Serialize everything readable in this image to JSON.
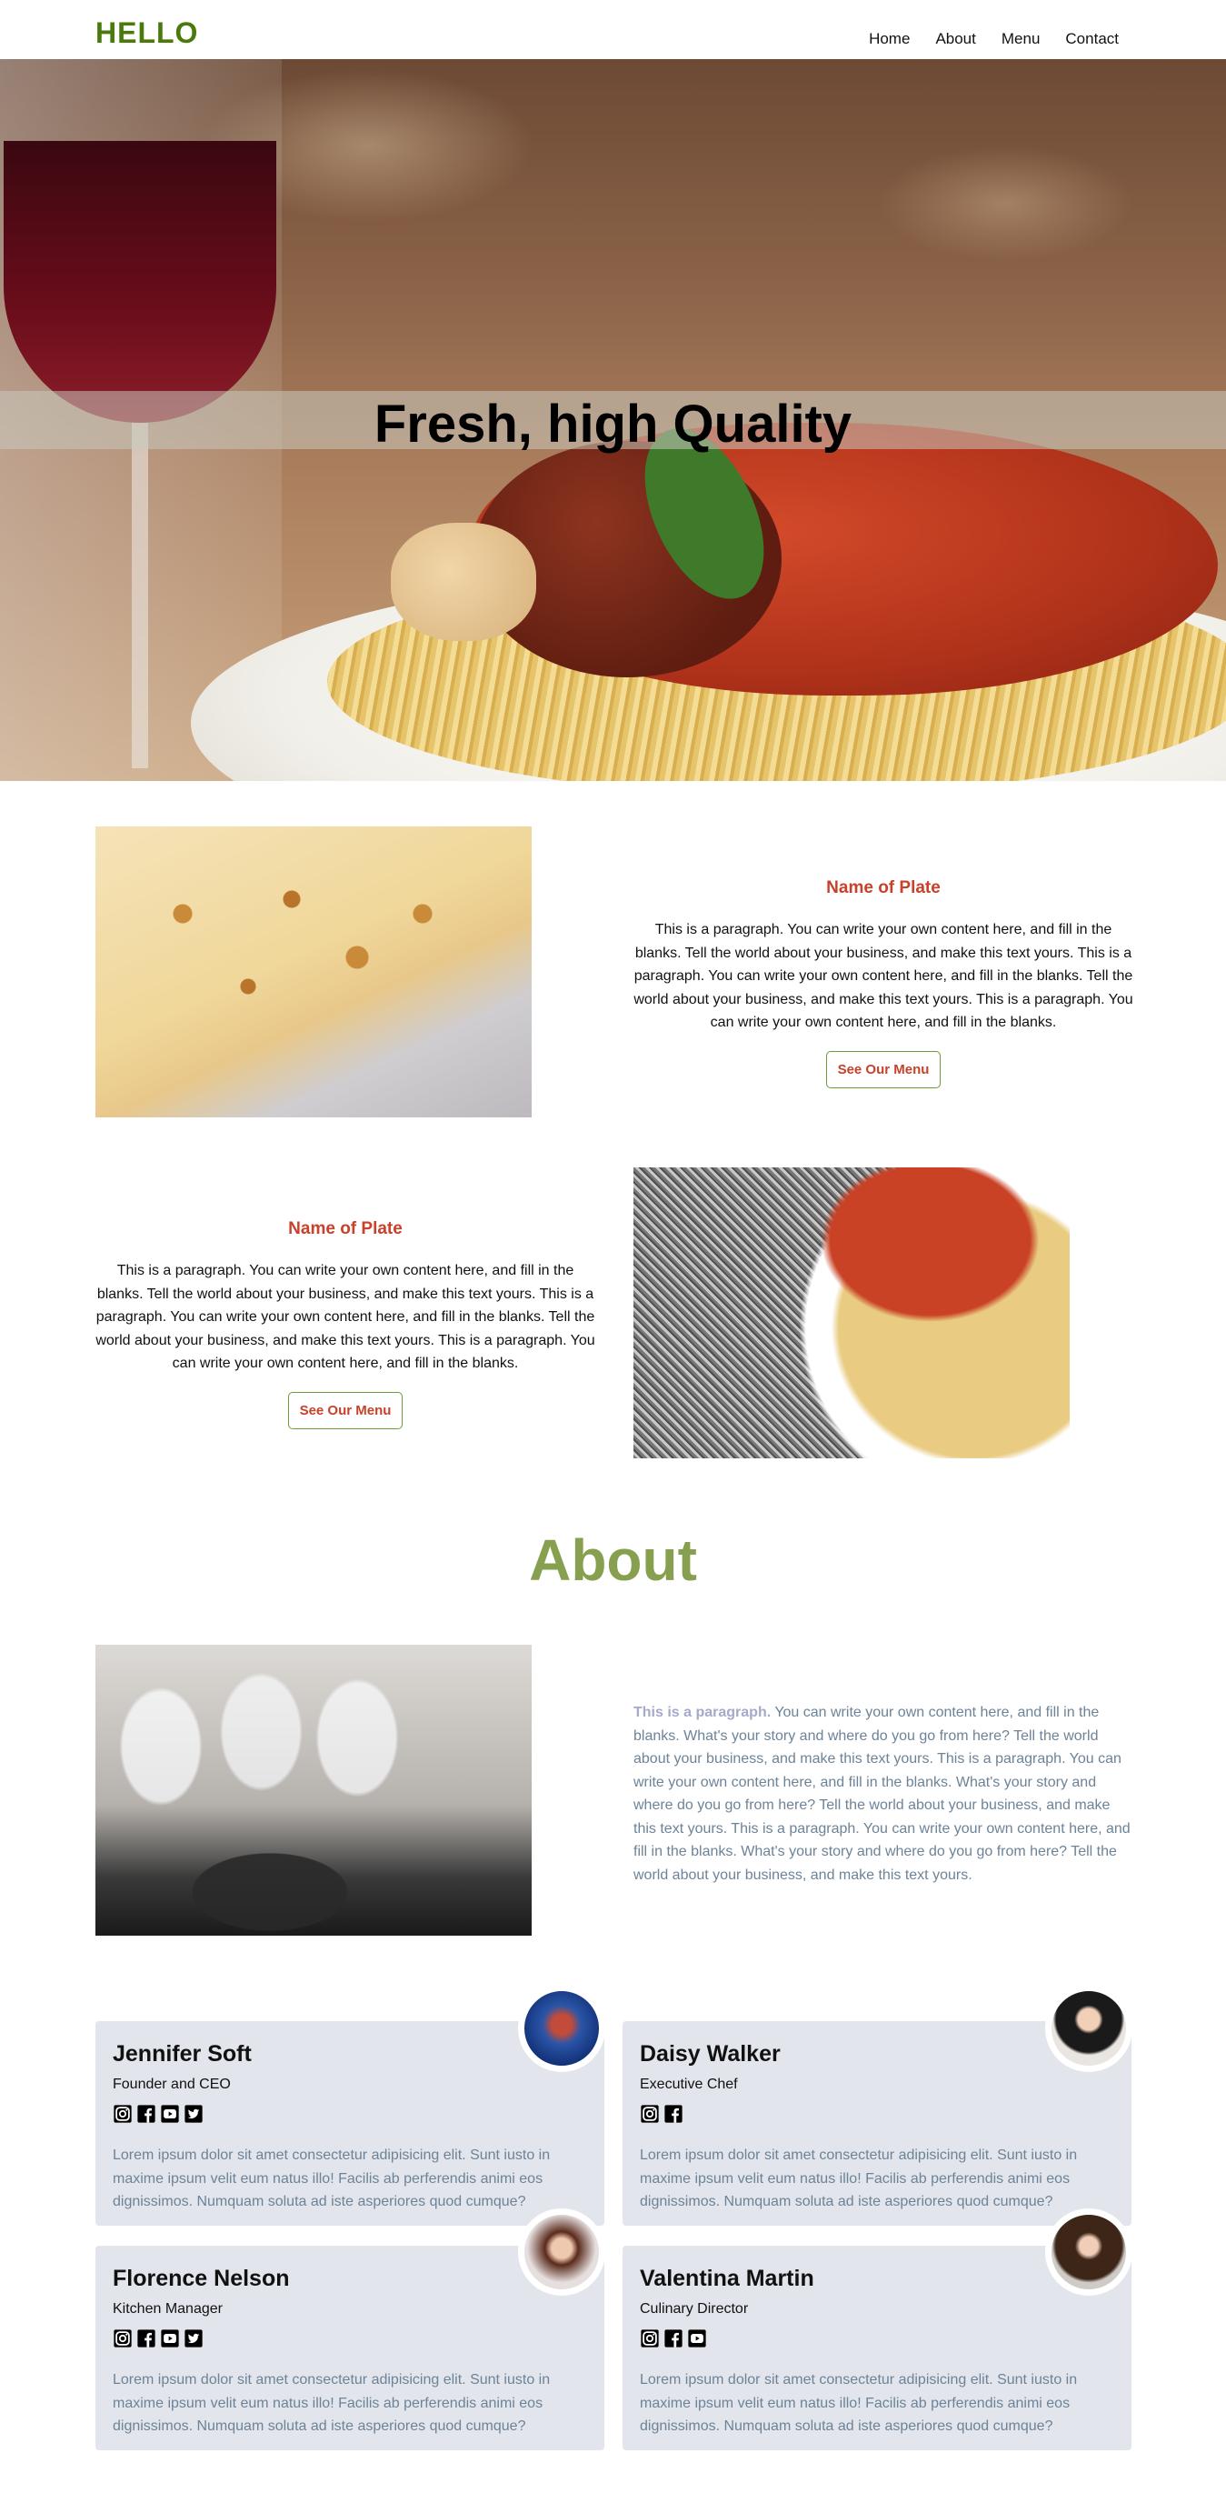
{
  "header": {
    "logo": "HELLO",
    "nav": [
      "Home",
      "About",
      "Menu",
      "Contact"
    ]
  },
  "hero": {
    "title": "Fresh, high Quality"
  },
  "features": [
    {
      "name": "Name of Plate",
      "paragraph": "This is a paragraph. You can write your own content here, and fill in the blanks. Tell the world about your business, and make this text yours. This is a paragraph. You can write your own content here, and fill in the blanks. Tell the world about your business, and make this text yours. This is a paragraph. You can write your own content here, and fill in the blanks.",
      "button": "See Our Menu"
    },
    {
      "name": "Name of Plate",
      "paragraph": "This is a paragraph. You can write your own content here, and fill in the blanks. Tell the world about your business, and make this text yours. This is a paragraph. You can write your own content here, and fill in the blanks. Tell the world about your business, and make this text yours. This is a paragraph. You can write your own content here, and fill in the blanks.",
      "button": "See Our Menu"
    }
  ],
  "about": {
    "heading": "About",
    "lead": "This is a paragraph.",
    "body": " You can write your own content here, and fill in the blanks. What's your story and where do you go from here? Tell the world about your business, and make this text yours. This is a paragraph. You can write your own content here, and fill in the blanks. What's your story and where do you go from here? Tell the world about your business, and make this text yours. This is a paragraph. You can write your own content here, and fill in the blanks. What's your story and where do you go from here? Tell the world about your business, and make this text yours."
  },
  "team": [
    {
      "name": "Jennifer Soft",
      "role": "Founder and CEO",
      "icons": [
        "instagram-icon",
        "facebook-icon",
        "youtube-icon",
        "twitter-icon"
      ],
      "bio": "Lorem ipsum dolor sit amet consectetur adipisicing elit. Sunt iusto in maxime ipsum velit eum natus illo! Facilis ab perferendis animi eos dignissimos. Numquam soluta ad iste asperiores quod cumque?"
    },
    {
      "name": "Daisy Walker",
      "role": "Executive Chef",
      "icons": [
        "instagram-icon",
        "facebook-icon"
      ],
      "bio": "Lorem ipsum dolor sit amet consectetur adipisicing elit. Sunt iusto in maxime ipsum velit eum natus illo! Facilis ab perferendis animi eos dignissimos. Numquam soluta ad iste asperiores quod cumque?"
    },
    {
      "name": "Florence Nelson",
      "role": "Kitchen Manager",
      "icons": [
        "instagram-icon",
        "facebook-icon",
        "youtube-icon",
        "twitter-icon"
      ],
      "bio": "Lorem ipsum dolor sit amet consectetur adipisicing elit. Sunt iusto in maxime ipsum velit eum natus illo! Facilis ab perferendis animi eos dignissimos. Numquam soluta ad iste asperiores quod cumque?"
    },
    {
      "name": "Valentina Martin",
      "role": "Culinary Director",
      "icons": [
        "instagram-icon",
        "facebook-icon",
        "youtube-icon"
      ],
      "bio": "Lorem ipsum dolor sit amet consectetur adipisicing elit. Sunt iusto in maxime ipsum velit eum natus illo! Facilis ab perferendis animi eos dignissimos. Numquam soluta ad iste asperiores quod cumque?"
    }
  ]
}
